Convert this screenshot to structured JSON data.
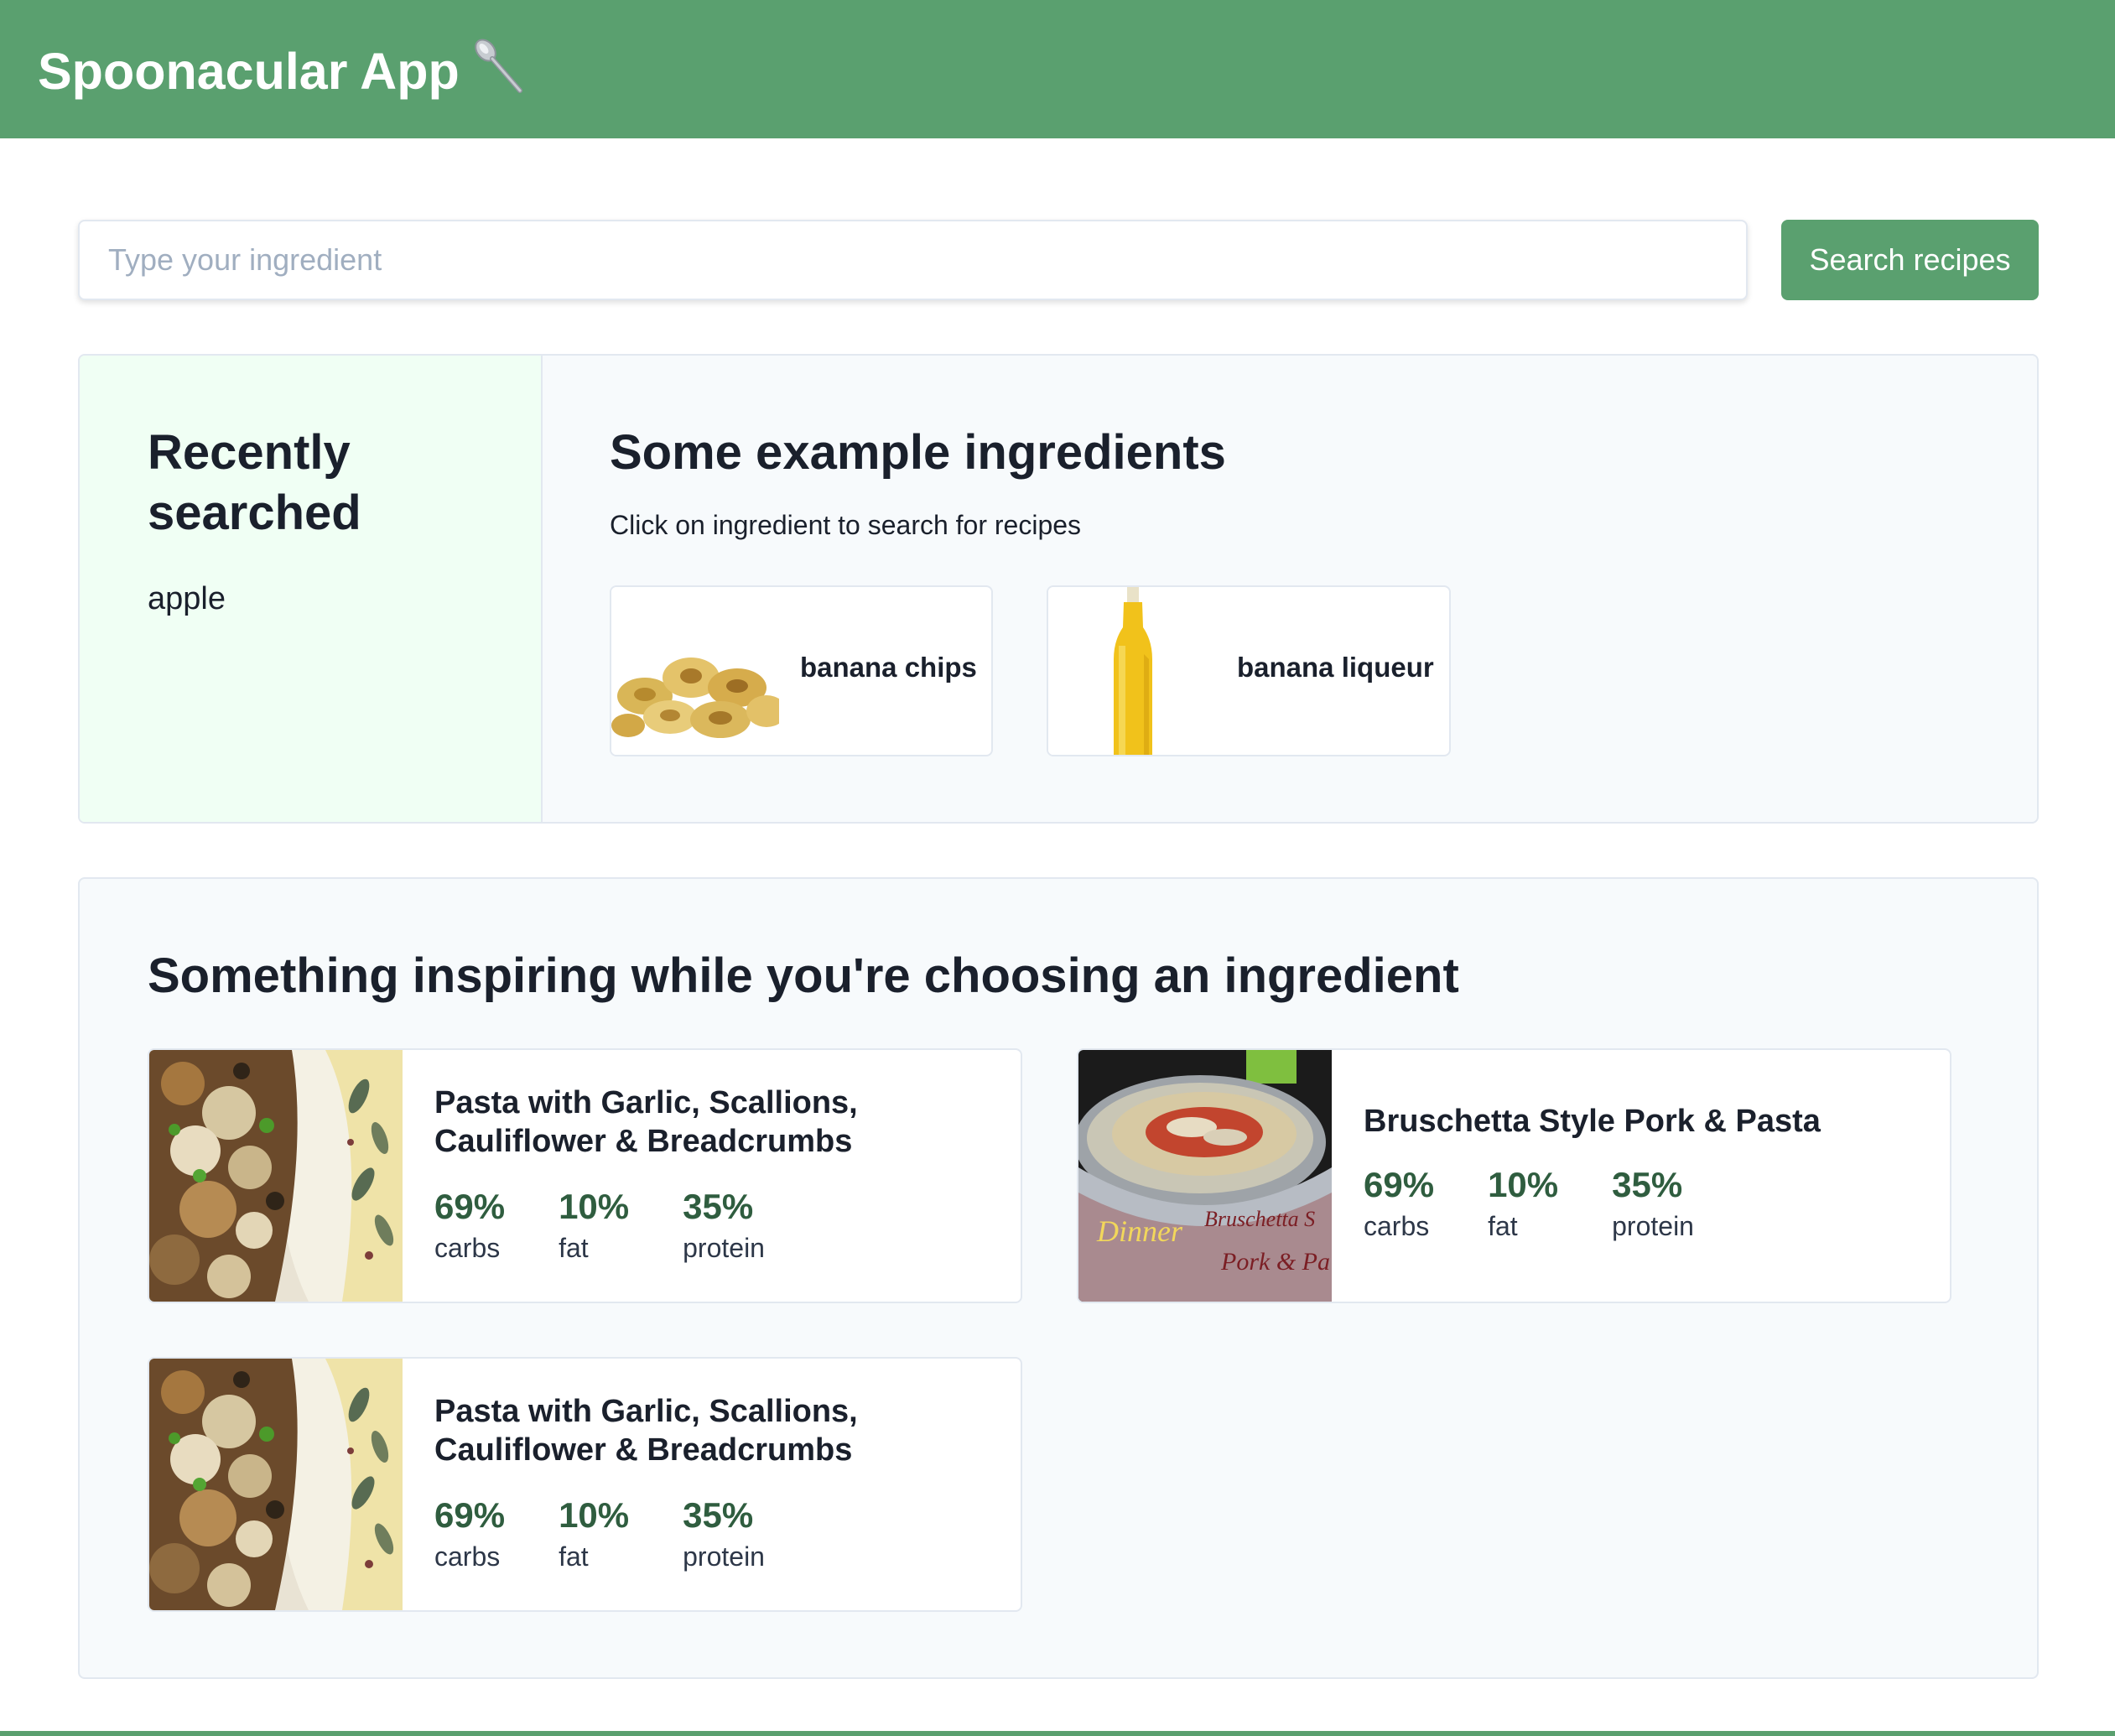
{
  "header": {
    "title": "Spoonacular App",
    "icon": "spoon-icon"
  },
  "search": {
    "placeholder": "Type your ingredient",
    "value": "",
    "button_label": "Search recipes"
  },
  "recent": {
    "heading": "Recently searched",
    "items": [
      "apple"
    ]
  },
  "examples": {
    "heading": "Some example ingredients",
    "subtitle": "Click on ingredient to search for recipes",
    "items": [
      {
        "name": "banana chips",
        "image": "banana-chips-image"
      },
      {
        "name": "banana liqueur",
        "image": "banana-liqueur-bottle-image"
      }
    ]
  },
  "inspiring": {
    "heading": "Something inspiring while you're choosing an ingredient",
    "recipes": [
      {
        "title": "Pasta with Garlic, Scallions, Cauliflower & Breadcrumbs",
        "image": "pasta-cauliflower-image",
        "stats": [
          {
            "value": "69%",
            "label": "carbs"
          },
          {
            "value": "10%",
            "label": "fat"
          },
          {
            "value": "35%",
            "label": "protein"
          }
        ]
      },
      {
        "title": "Bruschetta Style Pork & Pasta",
        "image": "bruschetta-pork-pasta-image",
        "image_overlay_text": "What to make for Dinner tonight? Bruschetta Style Pork & Pasta",
        "stats": [
          {
            "value": "69%",
            "label": "carbs"
          },
          {
            "value": "10%",
            "label": "fat"
          },
          {
            "value": "35%",
            "label": "protein"
          }
        ]
      },
      {
        "title": "Pasta with Garlic, Scallions, Cauliflower & Breadcrumbs",
        "image": "pasta-cauliflower-image",
        "stats": [
          {
            "value": "69%",
            "label": "carbs"
          },
          {
            "value": "10%",
            "label": "fat"
          },
          {
            "value": "35%",
            "label": "protein"
          }
        ]
      }
    ]
  },
  "colors": {
    "brand": "#5aa06f",
    "stat_value": "#2f5d3f",
    "panel_bg": "#f7fafc",
    "recent_bg": "#f0fff4"
  }
}
